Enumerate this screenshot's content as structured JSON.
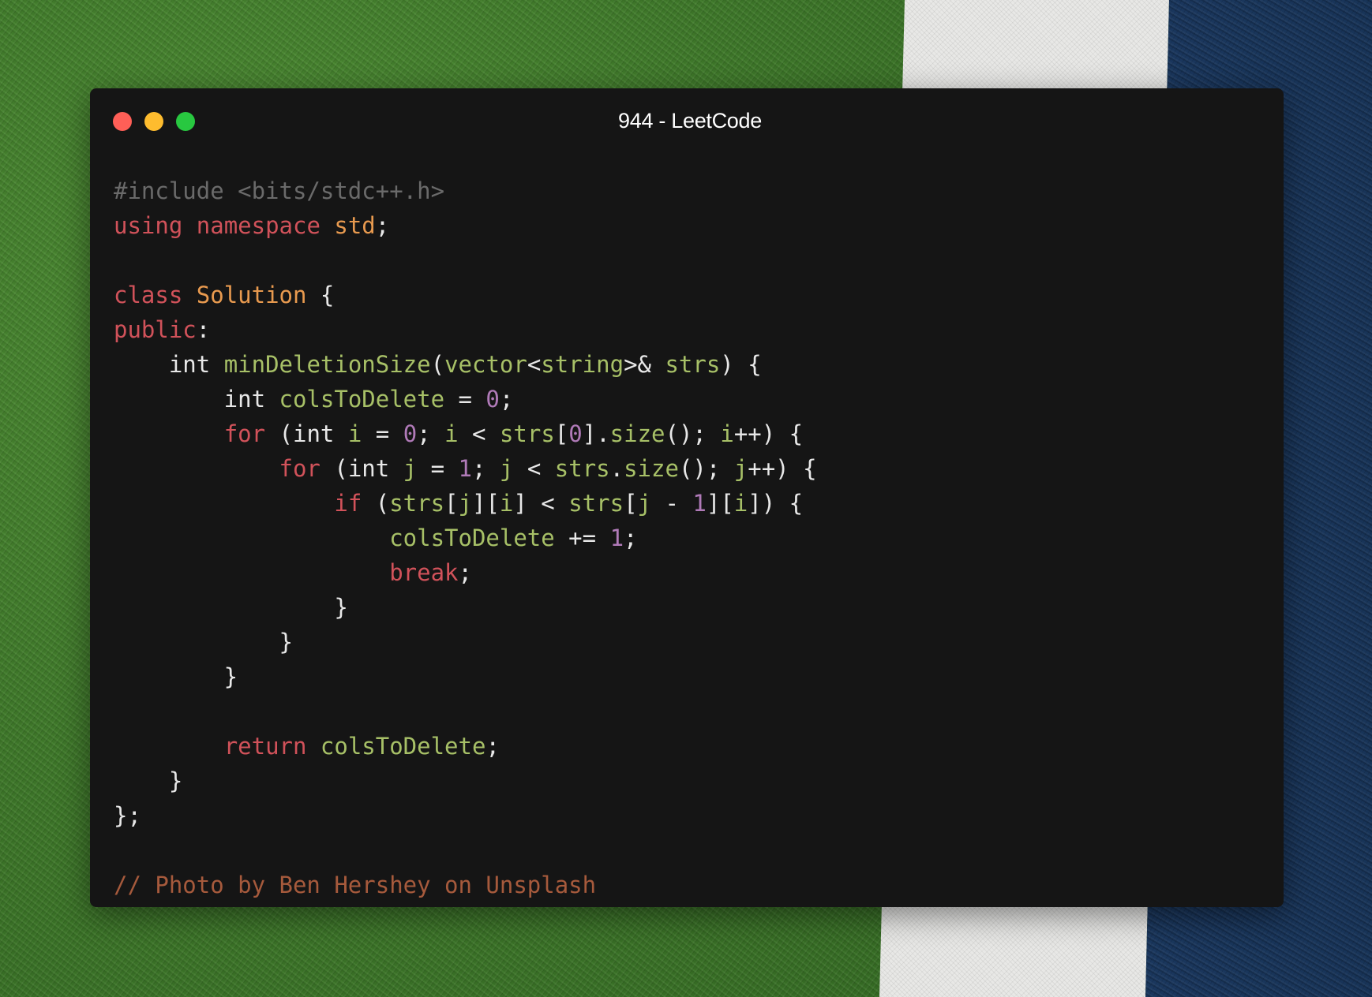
{
  "window": {
    "title": "944 - LeetCode",
    "buttons": [
      {
        "name": "close",
        "color": "#ff5f57"
      },
      {
        "name": "minimize",
        "color": "#febc2e"
      },
      {
        "name": "maximize",
        "color": "#28c840"
      }
    ]
  },
  "colors": {
    "background": "#151515",
    "meta": "#6a6a6a",
    "keyword": "#d1525a",
    "type": "#e89a4f",
    "plain": "#e8e8e8",
    "identifier": "#a7c067",
    "number": "#b07ab8",
    "comment": "#a65a3c"
  },
  "code": {
    "language": "C++",
    "lines": [
      [
        [
          "meta",
          "#include <bits/stdc++.h>"
        ]
      ],
      [
        [
          "kw",
          "using"
        ],
        [
          "plain",
          " "
        ],
        [
          "kw",
          "namespace"
        ],
        [
          "plain",
          " "
        ],
        [
          "type",
          "std"
        ],
        [
          "plain",
          ";"
        ]
      ],
      [],
      [
        [
          "kw",
          "class"
        ],
        [
          "plain",
          " "
        ],
        [
          "type",
          "Solution"
        ],
        [
          "plain",
          " {"
        ]
      ],
      [
        [
          "kw",
          "public"
        ],
        [
          "plain",
          ":"
        ]
      ],
      [
        [
          "plain",
          "    int "
        ],
        [
          "func",
          "minDeletionSize"
        ],
        [
          "plain",
          "("
        ],
        [
          "func",
          "vector"
        ],
        [
          "plain",
          "<"
        ],
        [
          "func",
          "string"
        ],
        [
          "plain",
          ">& "
        ],
        [
          "func",
          "strs"
        ],
        [
          "plain",
          ") {"
        ]
      ],
      [
        [
          "plain",
          "        int "
        ],
        [
          "func",
          "colsToDelete"
        ],
        [
          "plain",
          " = "
        ],
        [
          "num",
          "0"
        ],
        [
          "plain",
          ";"
        ]
      ],
      [
        [
          "plain",
          "        "
        ],
        [
          "kw",
          "for"
        ],
        [
          "plain",
          " (int "
        ],
        [
          "func",
          "i"
        ],
        [
          "plain",
          " = "
        ],
        [
          "num",
          "0"
        ],
        [
          "plain",
          "; "
        ],
        [
          "func",
          "i"
        ],
        [
          "plain",
          " < "
        ],
        [
          "func",
          "strs"
        ],
        [
          "plain",
          "["
        ],
        [
          "num",
          "0"
        ],
        [
          "plain",
          "]."
        ],
        [
          "func",
          "size"
        ],
        [
          "plain",
          "(); "
        ],
        [
          "func",
          "i"
        ],
        [
          "plain",
          "++) {"
        ]
      ],
      [
        [
          "plain",
          "            "
        ],
        [
          "kw",
          "for"
        ],
        [
          "plain",
          " (int "
        ],
        [
          "func",
          "j"
        ],
        [
          "plain",
          " = "
        ],
        [
          "num",
          "1"
        ],
        [
          "plain",
          "; "
        ],
        [
          "func",
          "j"
        ],
        [
          "plain",
          " < "
        ],
        [
          "func",
          "strs"
        ],
        [
          "plain",
          "."
        ],
        [
          "func",
          "size"
        ],
        [
          "plain",
          "(); "
        ],
        [
          "func",
          "j"
        ],
        [
          "plain",
          "++) {"
        ]
      ],
      [
        [
          "plain",
          "                "
        ],
        [
          "kw",
          "if"
        ],
        [
          "plain",
          " ("
        ],
        [
          "func",
          "strs"
        ],
        [
          "plain",
          "["
        ],
        [
          "func",
          "j"
        ],
        [
          "plain",
          "]["
        ],
        [
          "func",
          "i"
        ],
        [
          "plain",
          "] < "
        ],
        [
          "func",
          "strs"
        ],
        [
          "plain",
          "["
        ],
        [
          "func",
          "j"
        ],
        [
          "plain",
          " - "
        ],
        [
          "num",
          "1"
        ],
        [
          "plain",
          "]["
        ],
        [
          "func",
          "i"
        ],
        [
          "plain",
          "]) {"
        ]
      ],
      [
        [
          "plain",
          "                    "
        ],
        [
          "func",
          "colsToDelete"
        ],
        [
          "plain",
          " += "
        ],
        [
          "num",
          "1"
        ],
        [
          "plain",
          ";"
        ]
      ],
      [
        [
          "plain",
          "                    "
        ],
        [
          "kw",
          "break"
        ],
        [
          "plain",
          ";"
        ]
      ],
      [
        [
          "plain",
          "                }"
        ]
      ],
      [
        [
          "plain",
          "            }"
        ]
      ],
      [
        [
          "plain",
          "        }"
        ]
      ],
      [],
      [
        [
          "plain",
          "        "
        ],
        [
          "kw",
          "return"
        ],
        [
          "plain",
          " "
        ],
        [
          "func",
          "colsToDelete"
        ],
        [
          "plain",
          ";"
        ]
      ],
      [
        [
          "plain",
          "    }"
        ]
      ],
      [
        [
          "plain",
          "};"
        ]
      ],
      [],
      [
        [
          "comment",
          "// Photo by Ben Hershey on Unsplash"
        ]
      ]
    ]
  }
}
